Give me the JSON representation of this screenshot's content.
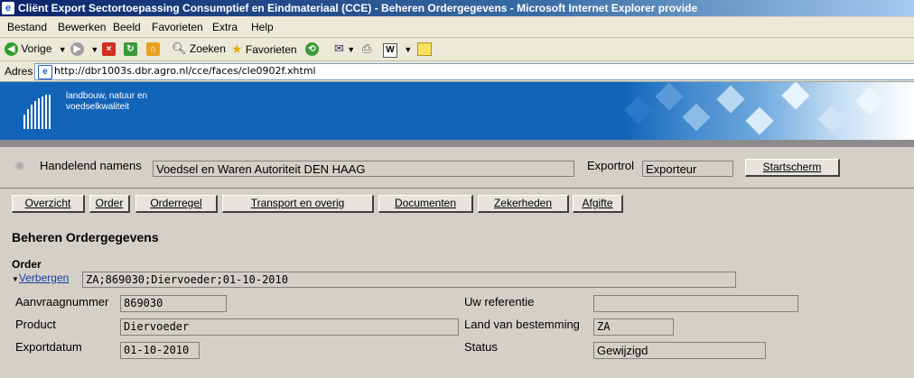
{
  "window": {
    "title": "Cliënt Export Sectortoepassing Consumptief en Eindmateriaal (CCE) - Beheren Ordergegevens - Microsoft Internet Explorer provide"
  },
  "menu": [
    "Bestand",
    "Bewerken",
    "Beeld",
    "Favorieten",
    "Extra",
    "Help"
  ],
  "toolbar": {
    "back": "Vorige",
    "search": "Zoeken",
    "favorites": "Favorieten"
  },
  "address": {
    "label": "Adres",
    "url": "http://dbr1003s.dbr.agro.nl/cce/faces/cle0902f.xhtml"
  },
  "header": {
    "org_line1": "landbouw, natuur en",
    "org_line2": "voedselkwaliteit"
  },
  "top": {
    "handelend_label": "Handelend namens",
    "handelend_value": "Voedsel en Waren Autoriteit DEN HAAG",
    "exportrol_label": "Exportrol",
    "exportrol_value": "Exporteur",
    "startscherm_label": "Startscherm"
  },
  "nav": [
    "Overzicht",
    "Order",
    "Orderregel",
    "Transport en overig",
    "Documenten",
    "Zekerheden",
    "Afgifte"
  ],
  "page": {
    "title": "Beheren Ordergegevens",
    "section": "Order",
    "hide_link": "Verbergen",
    "summary": "ZA;869030;Diervoeder;01-10-2010"
  },
  "order": {
    "aanvraagnummer_label": "Aanvraagnummer",
    "aanvraagnummer": "869030",
    "referentie_label": "Uw referentie",
    "referentie": "",
    "product_label": "Product",
    "product": "Diervoeder",
    "land_label": "Land van bestemming",
    "land": "ZA",
    "exportdatum_label": "Exportdatum",
    "exportdatum": "01-10-2010",
    "status_label": "Status",
    "status": "Gewijzigd"
  },
  "colors": {
    "header_blue": "#1264b8",
    "window_gray": "#d4d0c8"
  }
}
